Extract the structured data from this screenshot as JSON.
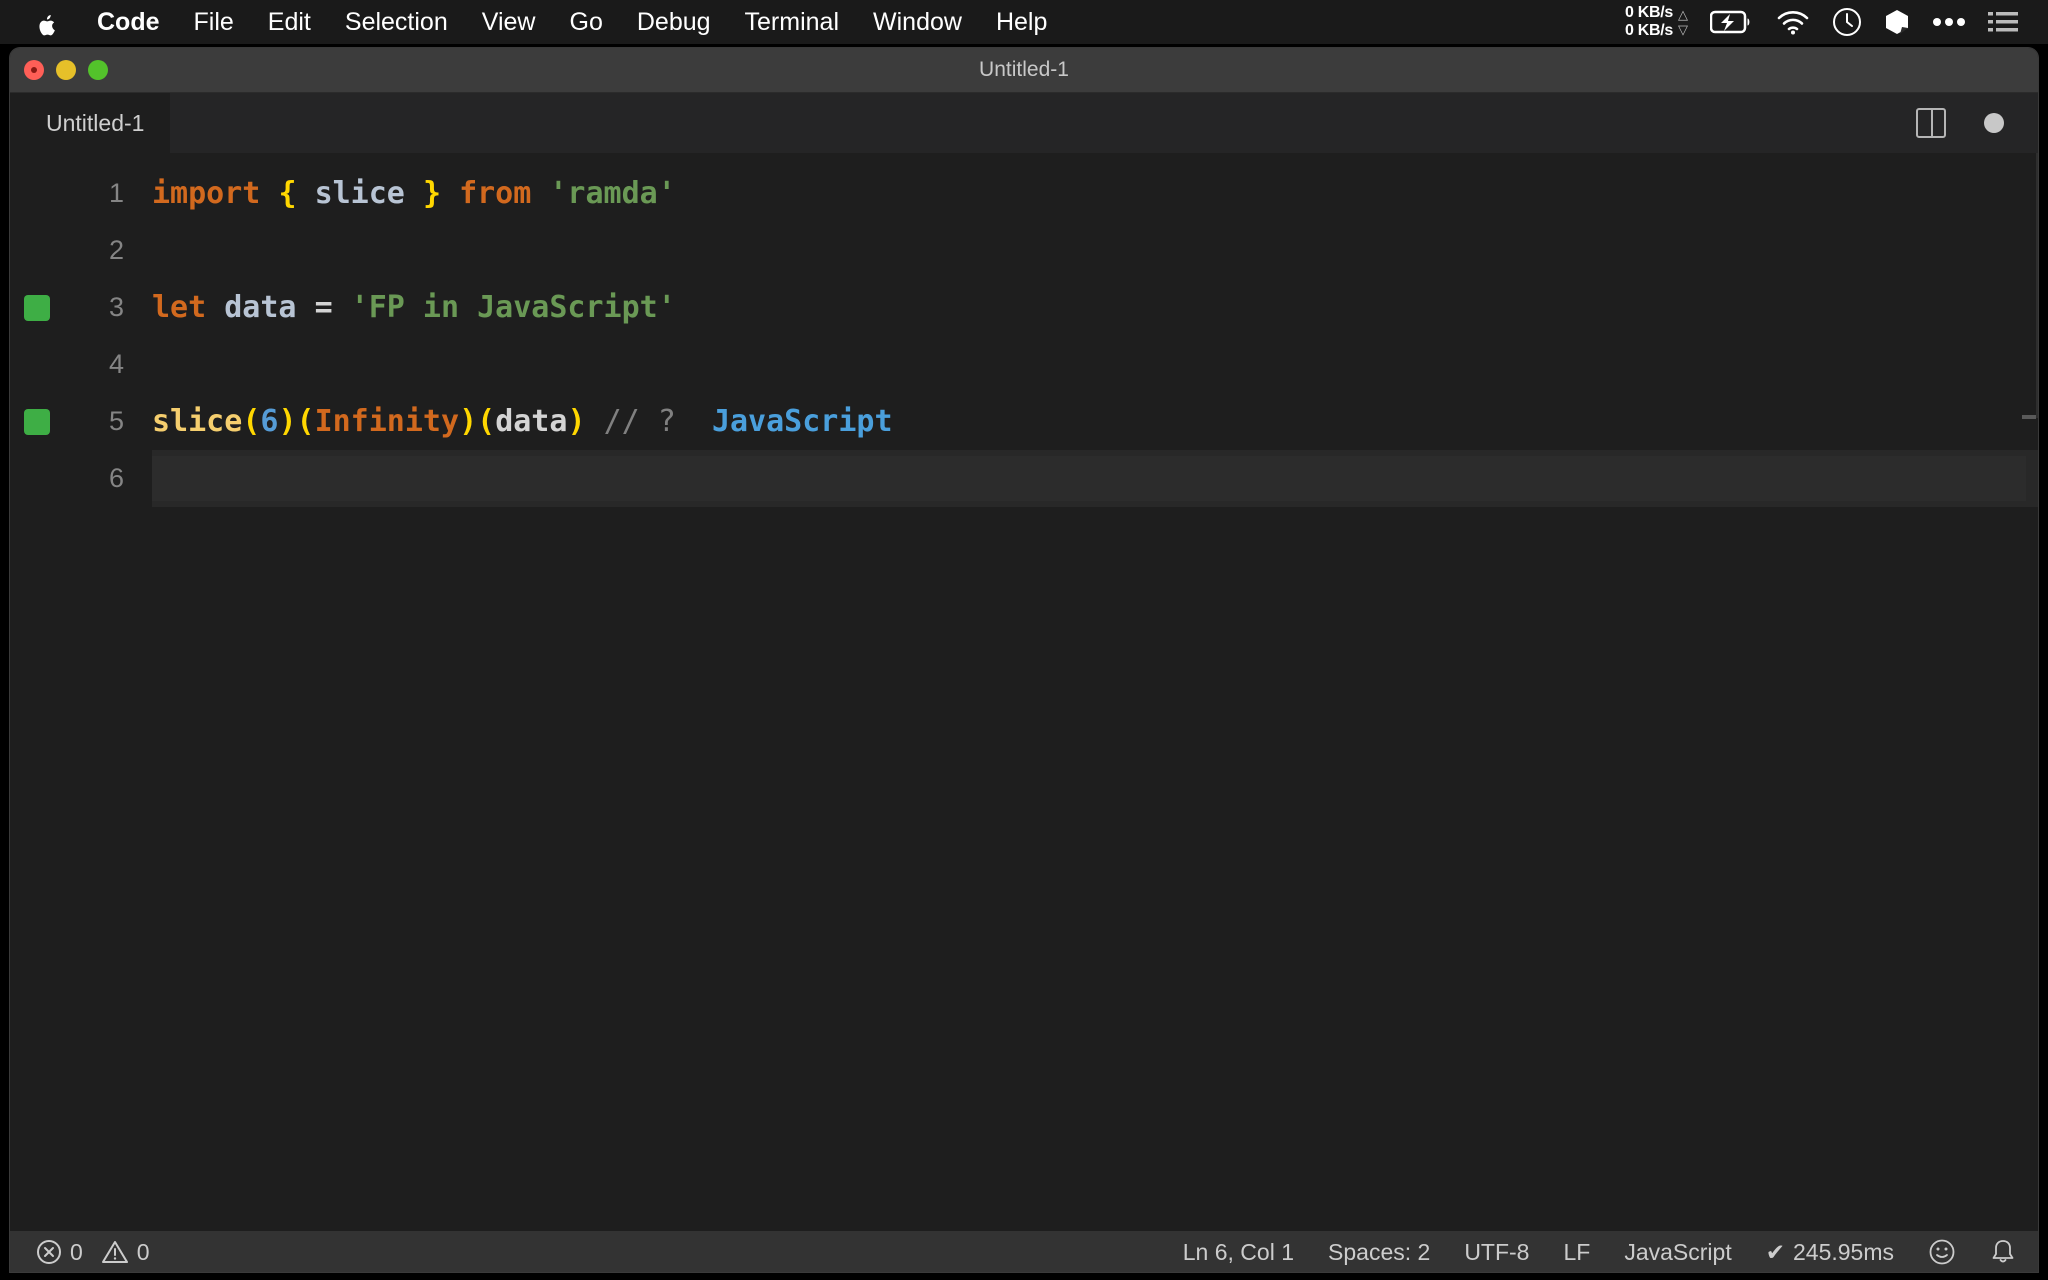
{
  "menubar": {
    "apple_icon": "apple-logo-icon",
    "items": [
      {
        "label": "Code",
        "bold": true
      },
      {
        "label": "File",
        "bold": false
      },
      {
        "label": "Edit",
        "bold": false
      },
      {
        "label": "Selection",
        "bold": false
      },
      {
        "label": "View",
        "bold": false
      },
      {
        "label": "Go",
        "bold": false
      },
      {
        "label": "Debug",
        "bold": false
      },
      {
        "label": "Terminal",
        "bold": false
      },
      {
        "label": "Window",
        "bold": false
      },
      {
        "label": "Help",
        "bold": false
      }
    ],
    "tray": {
      "net_up": "0 KB/s",
      "net_down": "0 KB/s",
      "up_arrow": "△",
      "down_arrow": "▽",
      "icons": [
        "battery-charging-icon",
        "wifi-icon",
        "time-machine-icon",
        "dropbox-icon",
        "more-icon",
        "control-center-icon"
      ]
    }
  },
  "window": {
    "title": "Untitled-1",
    "traffic_lights": [
      "close-button",
      "minimize-button",
      "maximize-button"
    ]
  },
  "tabbar": {
    "tabs": [
      {
        "label": "Untitled-1",
        "active": true
      }
    ],
    "split_editor_label": "split-editor",
    "dirty_indicator": "unsaved-changes"
  },
  "editor": {
    "lines": [
      {
        "number": "1",
        "marker": false,
        "current": false,
        "tokens": [
          {
            "t": "import",
            "c": "t-keyword"
          },
          {
            "t": " ",
            "c": "t-plain"
          },
          {
            "t": "{",
            "c": "t-brace"
          },
          {
            "t": " ",
            "c": "t-plain"
          },
          {
            "t": "slice",
            "c": "t-var"
          },
          {
            "t": " ",
            "c": "t-plain"
          },
          {
            "t": "}",
            "c": "t-brace"
          },
          {
            "t": " ",
            "c": "t-plain"
          },
          {
            "t": "from",
            "c": "t-keyword"
          },
          {
            "t": " ",
            "c": "t-plain"
          },
          {
            "t": "'ramda'",
            "c": "t-string"
          }
        ]
      },
      {
        "number": "2",
        "marker": false,
        "current": false,
        "tokens": []
      },
      {
        "number": "3",
        "marker": true,
        "current": false,
        "tokens": [
          {
            "t": "let",
            "c": "t-keyword"
          },
          {
            "t": " ",
            "c": "t-plain"
          },
          {
            "t": "data",
            "c": "t-var"
          },
          {
            "t": " ",
            "c": "t-plain"
          },
          {
            "t": "=",
            "c": "t-op"
          },
          {
            "t": " ",
            "c": "t-plain"
          },
          {
            "t": "'FP in JavaScript'",
            "c": "t-string"
          }
        ]
      },
      {
        "number": "4",
        "marker": false,
        "current": false,
        "tokens": []
      },
      {
        "number": "5",
        "marker": true,
        "current": false,
        "tokens": [
          {
            "t": "slice",
            "c": "t-func"
          },
          {
            "t": "(",
            "c": "t-paren"
          },
          {
            "t": "6",
            "c": "t-number"
          },
          {
            "t": ")",
            "c": "t-paren"
          },
          {
            "t": "(",
            "c": "t-paren"
          },
          {
            "t": "Infinity",
            "c": "t-const"
          },
          {
            "t": ")",
            "c": "t-paren"
          },
          {
            "t": "(",
            "c": "t-paren"
          },
          {
            "t": "data",
            "c": "t-plain"
          },
          {
            "t": ")",
            "c": "t-paren"
          },
          {
            "t": " ",
            "c": "t-plain"
          },
          {
            "t": "// ?",
            "c": "t-comment"
          },
          {
            "t": "  ",
            "c": "t-plain"
          },
          {
            "t": "JavaScript",
            "c": "t-result"
          }
        ]
      },
      {
        "number": "6",
        "marker": false,
        "current": true,
        "tokens": []
      }
    ]
  },
  "statusbar": {
    "errors_icon": "error-circle-icon",
    "errors_count": "0",
    "warnings_icon": "warning-triangle-icon",
    "warnings_count": "0",
    "cursor_position": "Ln 6, Col 1",
    "indentation": "Spaces: 2",
    "encoding": "UTF-8",
    "eol": "LF",
    "language": "JavaScript",
    "run_check": "✔",
    "run_time": "245.95ms",
    "feedback_icon": "smiley-icon",
    "notifications_icon": "bell-icon"
  }
}
